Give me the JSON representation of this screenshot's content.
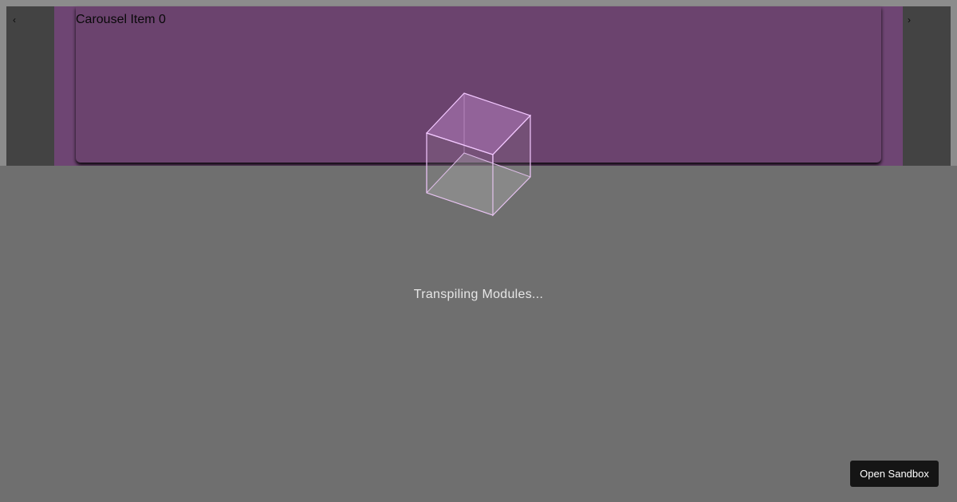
{
  "preview": {
    "carousel": {
      "item_title": "Carousel Item 0",
      "prev_arrow": "‹",
      "next_arrow": "›"
    }
  },
  "loader": {
    "icon": "cube-icon",
    "status_text": "Transpiling Modules..."
  },
  "actions": {
    "open_sandbox_label": "Open Sandbox"
  },
  "colors": {
    "overlay_background": "#6f6f6f",
    "carousel_card": "#c37ac9",
    "cube_stroke": "#f3c8ff",
    "button_background": "#151515"
  }
}
